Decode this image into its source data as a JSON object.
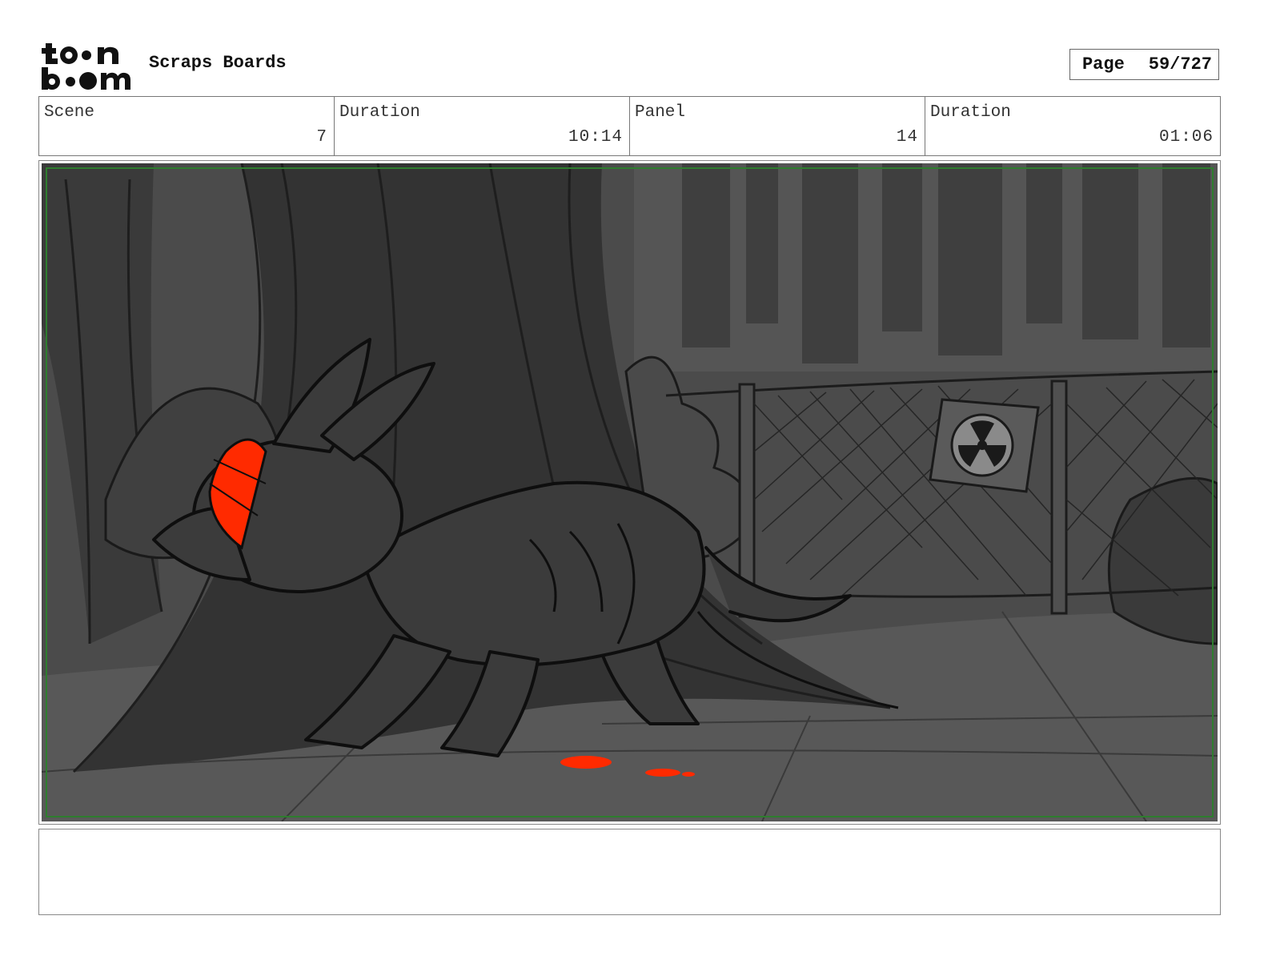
{
  "header": {
    "logo_text": "toon boom",
    "title": "Scraps Boards",
    "page_label": "Page",
    "page_value": "59/727"
  },
  "info": {
    "scene_label": "Scene",
    "scene_value": "7",
    "scene_duration_label": "Duration",
    "scene_duration_value": "10:14",
    "panel_label": "Panel",
    "panel_value": "14",
    "panel_duration_label": "Duration",
    "panel_duration_value": "01:06"
  },
  "panel": {
    "accent_color": "#ff2a00",
    "safe_frame_color": "#2e7d2e",
    "icons": [
      "radiation-sign-icon"
    ]
  },
  "notes": {
    "text": ""
  }
}
